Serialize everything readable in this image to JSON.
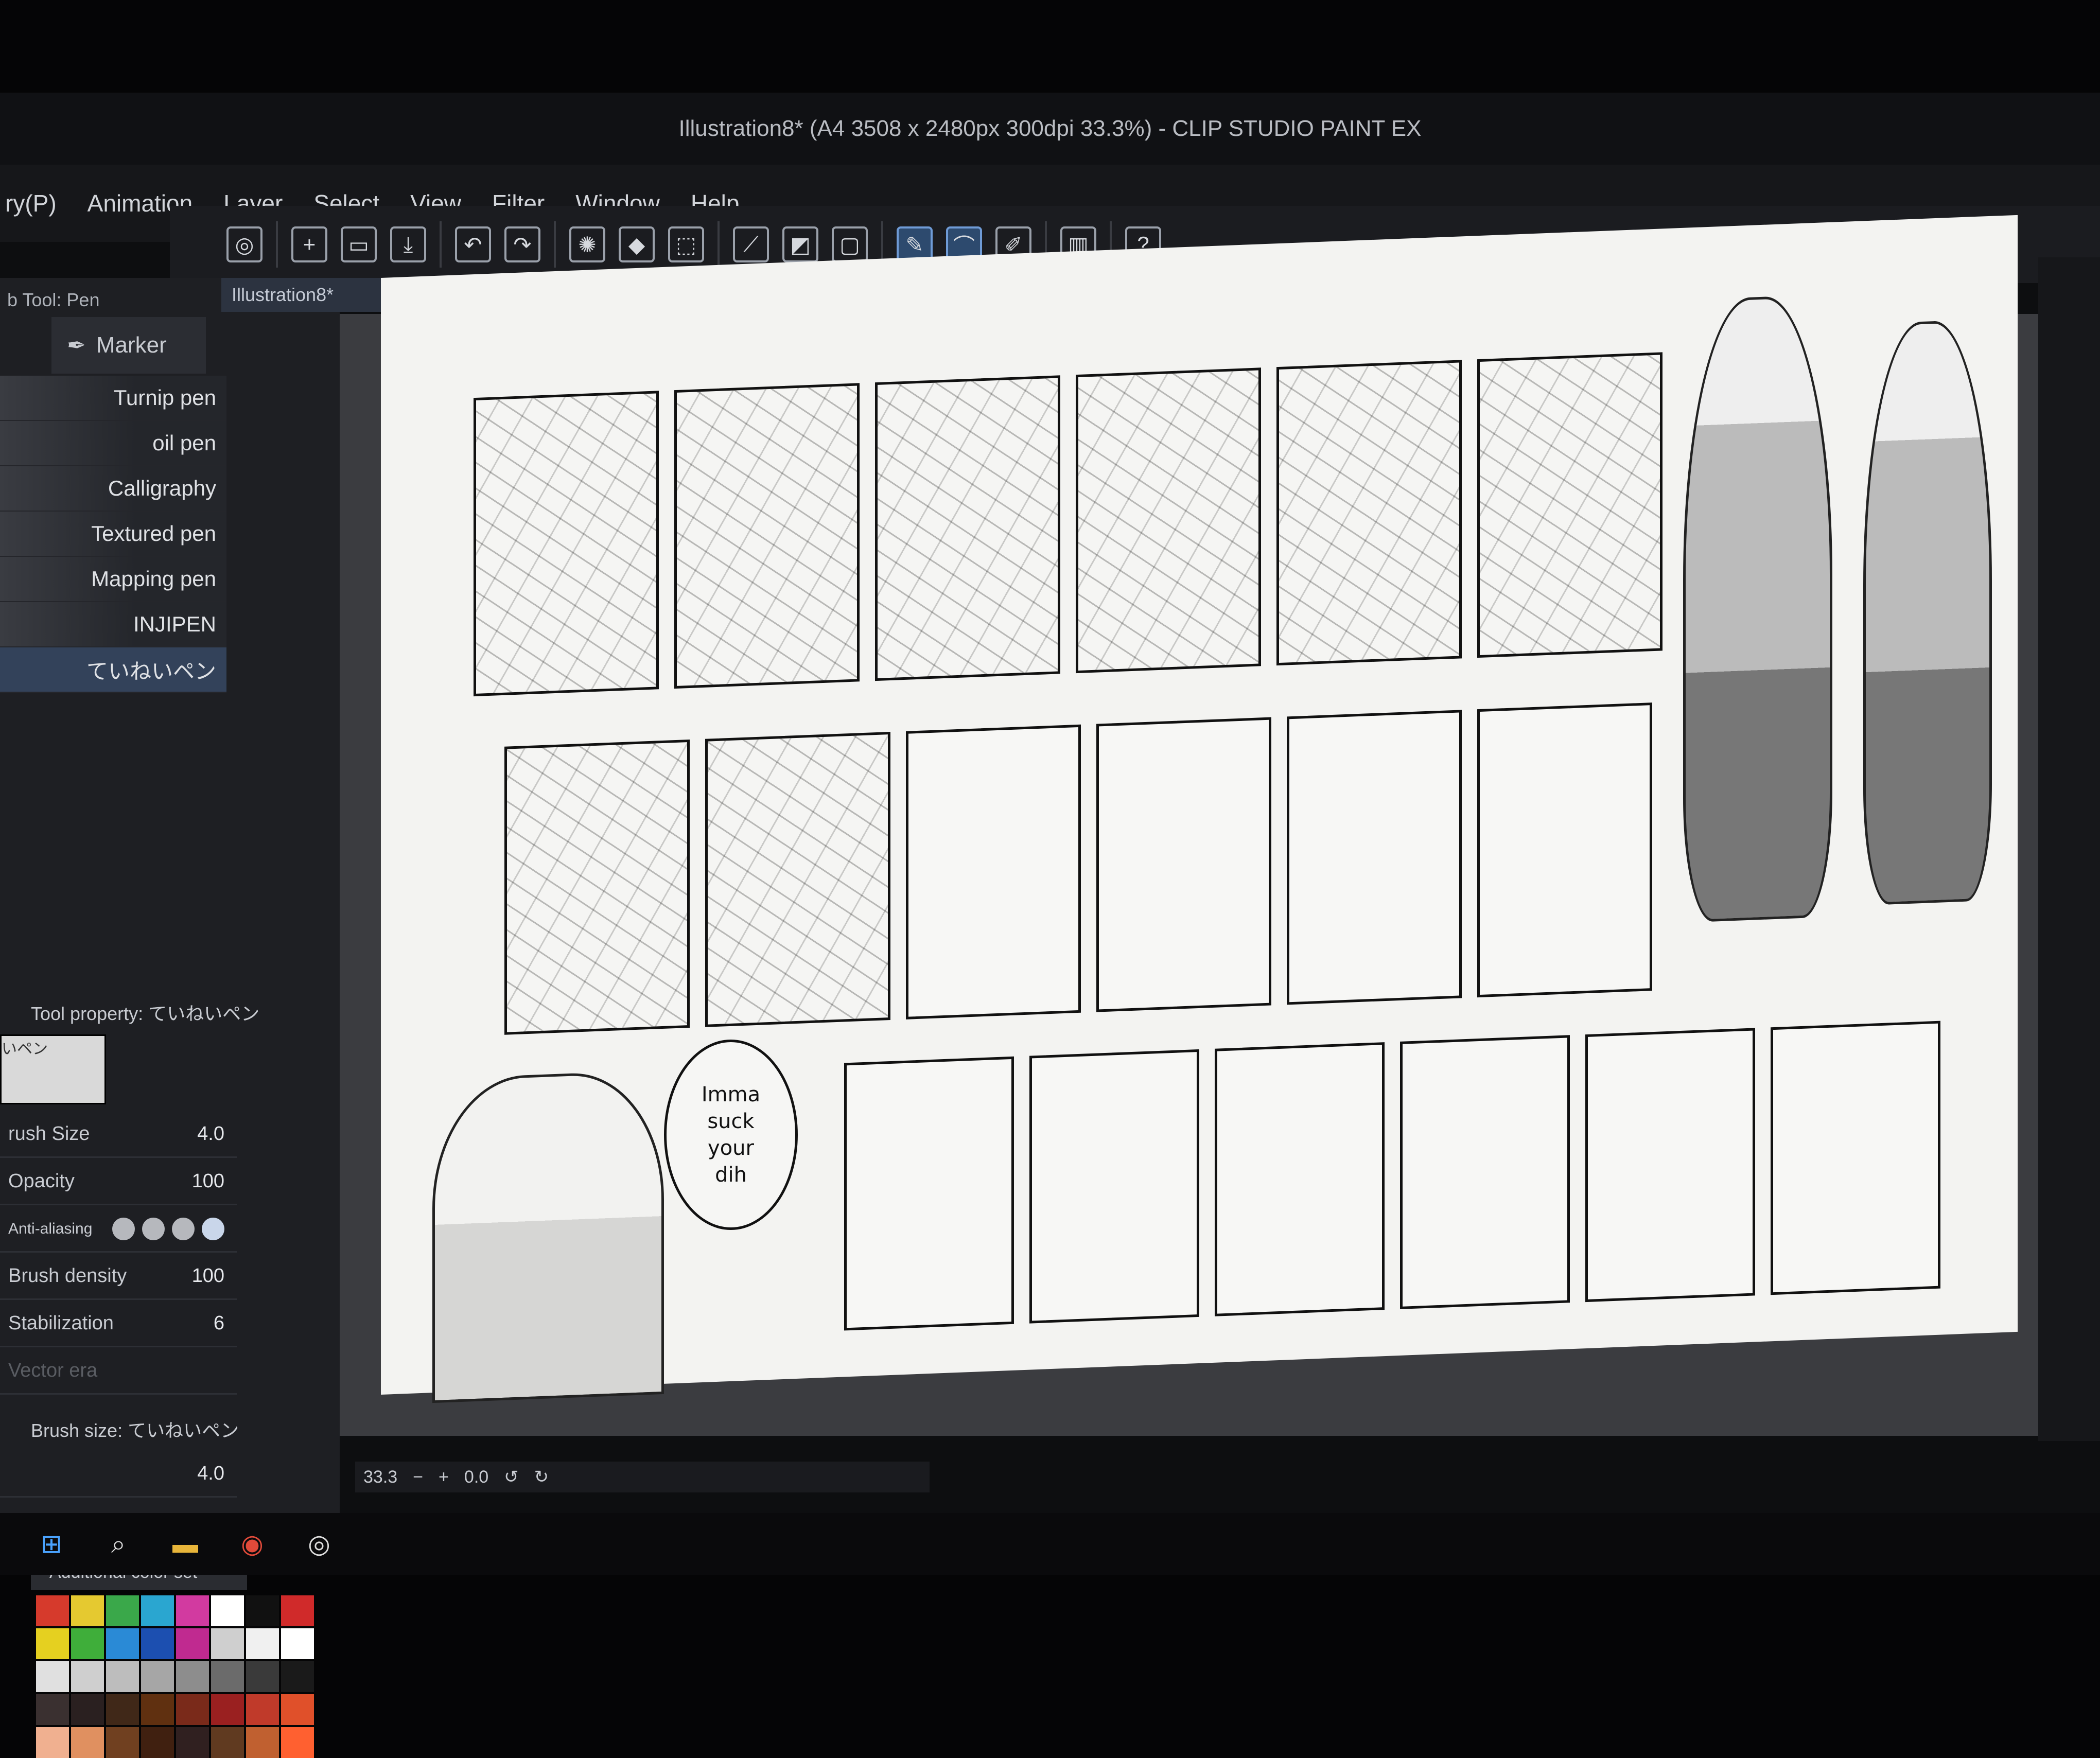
{
  "window": {
    "title": "Illustration8* (A4 3508 x 2480px 300dpi 33.3%) - CLIP STUDIO PAINT EX"
  },
  "menu": [
    "ry(P)",
    "Animation",
    "Layer",
    "Select",
    "View",
    "Filter",
    "Window",
    "Help"
  ],
  "toolbar": {
    "icons": [
      "clip-studio-icon",
      "new-canvas-icon",
      "open-icon",
      "save-icon",
      "undo-icon",
      "redo-icon",
      "loading-icon",
      "fill-icon",
      "transform-icon",
      "snap-icon",
      "snap-ruler-icon",
      "snap-grid-icon",
      "pen-active-icon",
      "brush-icon",
      "eraser-icon",
      "tablet-icon",
      "help-icon"
    ]
  },
  "doc_tab": {
    "label": "Illustration8*"
  },
  "sub_tool": {
    "header": "b Tool: Pen",
    "group": "Marker",
    "brushes": [
      "Turnip pen",
      "oil pen",
      "Calligraphy",
      "Textured pen",
      "Mapping pen",
      "INJIPEN",
      "ていねいペン"
    ],
    "selected_index": 6
  },
  "tool_property": {
    "header": "Tool property: ていねいペン",
    "preview_label": "いペン",
    "brush_size_label": "rush Size",
    "brush_size": "4.0",
    "opacity_label": "Opacity",
    "opacity": "100",
    "anti_aliasing_label": "Anti-aliasing",
    "brush_density_label": "Brush density",
    "brush_density": "100",
    "stabilization_label": "Stabilization",
    "stabilization": "6",
    "vector_label": "Vector era"
  },
  "brush_size_panel": {
    "header": "Brush size: ていねいペン",
    "value": "4.0"
  },
  "color_set": {
    "header": "Additional color set",
    "colors": [
      "#d63a2c",
      "#e5c930",
      "#3aa84a",
      "#2aa6d0",
      "#d23aa0",
      "#ffffff",
      "#111111",
      "#d02a2a",
      "#e5d020",
      "#3fae3a",
      "#2a8ad6",
      "#1c4fb0",
      "#c02a90",
      "#cfcfcf",
      "#f0f0f0",
      "#ffffff",
      "#e0e0e0",
      "#cfcfcf",
      "#bdbdbd",
      "#a6a6a6",
      "#8d8d8d",
      "#6b6b6b",
      "#3a3a3a",
      "#1a1a1a",
      "#3a3030",
      "#2a2020",
      "#402818",
      "#603010",
      "#7a2a1a",
      "#9a2020",
      "#c03a2a",
      "#e0502a",
      "#f0b090",
      "#e09060",
      "#704020",
      "#402010",
      "#302020",
      "#603a20",
      "#c06030",
      "#ff6030"
    ]
  },
  "canvas": {
    "speech_bubble": "Imma\nsuck\nyour\ndih"
  },
  "status_bar": {
    "zoom": "33.3",
    "rotation": "0.0"
  },
  "taskbar": {
    "icons": [
      "windows-start-icon",
      "search-icon",
      "file-explorer-icon",
      "chrome-icon",
      "clip-studio-icon"
    ]
  }
}
